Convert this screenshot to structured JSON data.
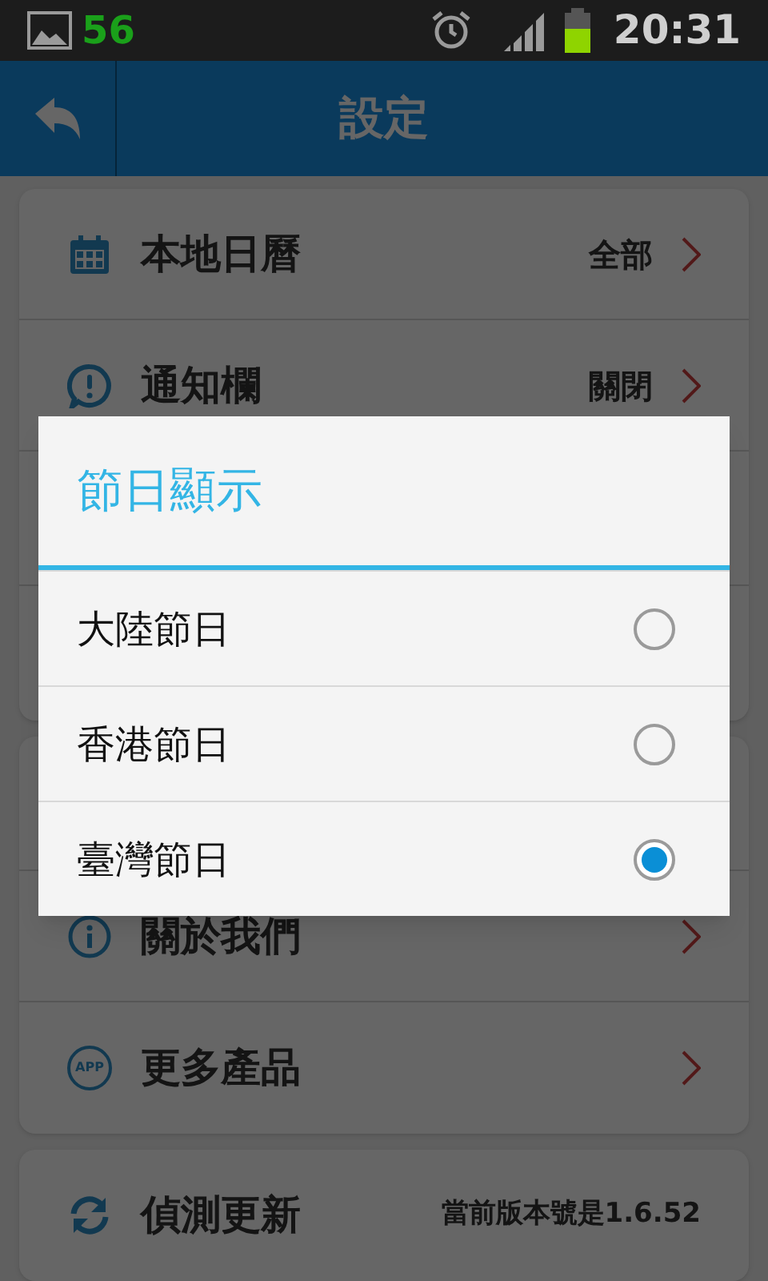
{
  "status_bar": {
    "notification_count": "56",
    "time": "20:31"
  },
  "header": {
    "title": "設定"
  },
  "groups": [
    {
      "rows": [
        {
          "label": "本地日曆",
          "value": "全部",
          "chevron": true
        },
        {
          "label": "通知欄",
          "value": "關閉",
          "chevron": true
        }
      ]
    },
    {
      "rows": [
        {
          "label": "關於我們",
          "chevron": true
        },
        {
          "label": "更多產品",
          "chevron": true,
          "icon_text": "APP"
        }
      ]
    },
    {
      "rows": [
        {
          "label": "偵測更新",
          "value": "當前版本號是1.6.52",
          "chevron": false
        }
      ]
    }
  ],
  "dialog": {
    "title": "節日顯示",
    "options": [
      {
        "label": "大陸節日",
        "selected": false
      },
      {
        "label": "香港節日",
        "selected": false
      },
      {
        "label": "臺灣節日",
        "selected": true
      }
    ]
  }
}
